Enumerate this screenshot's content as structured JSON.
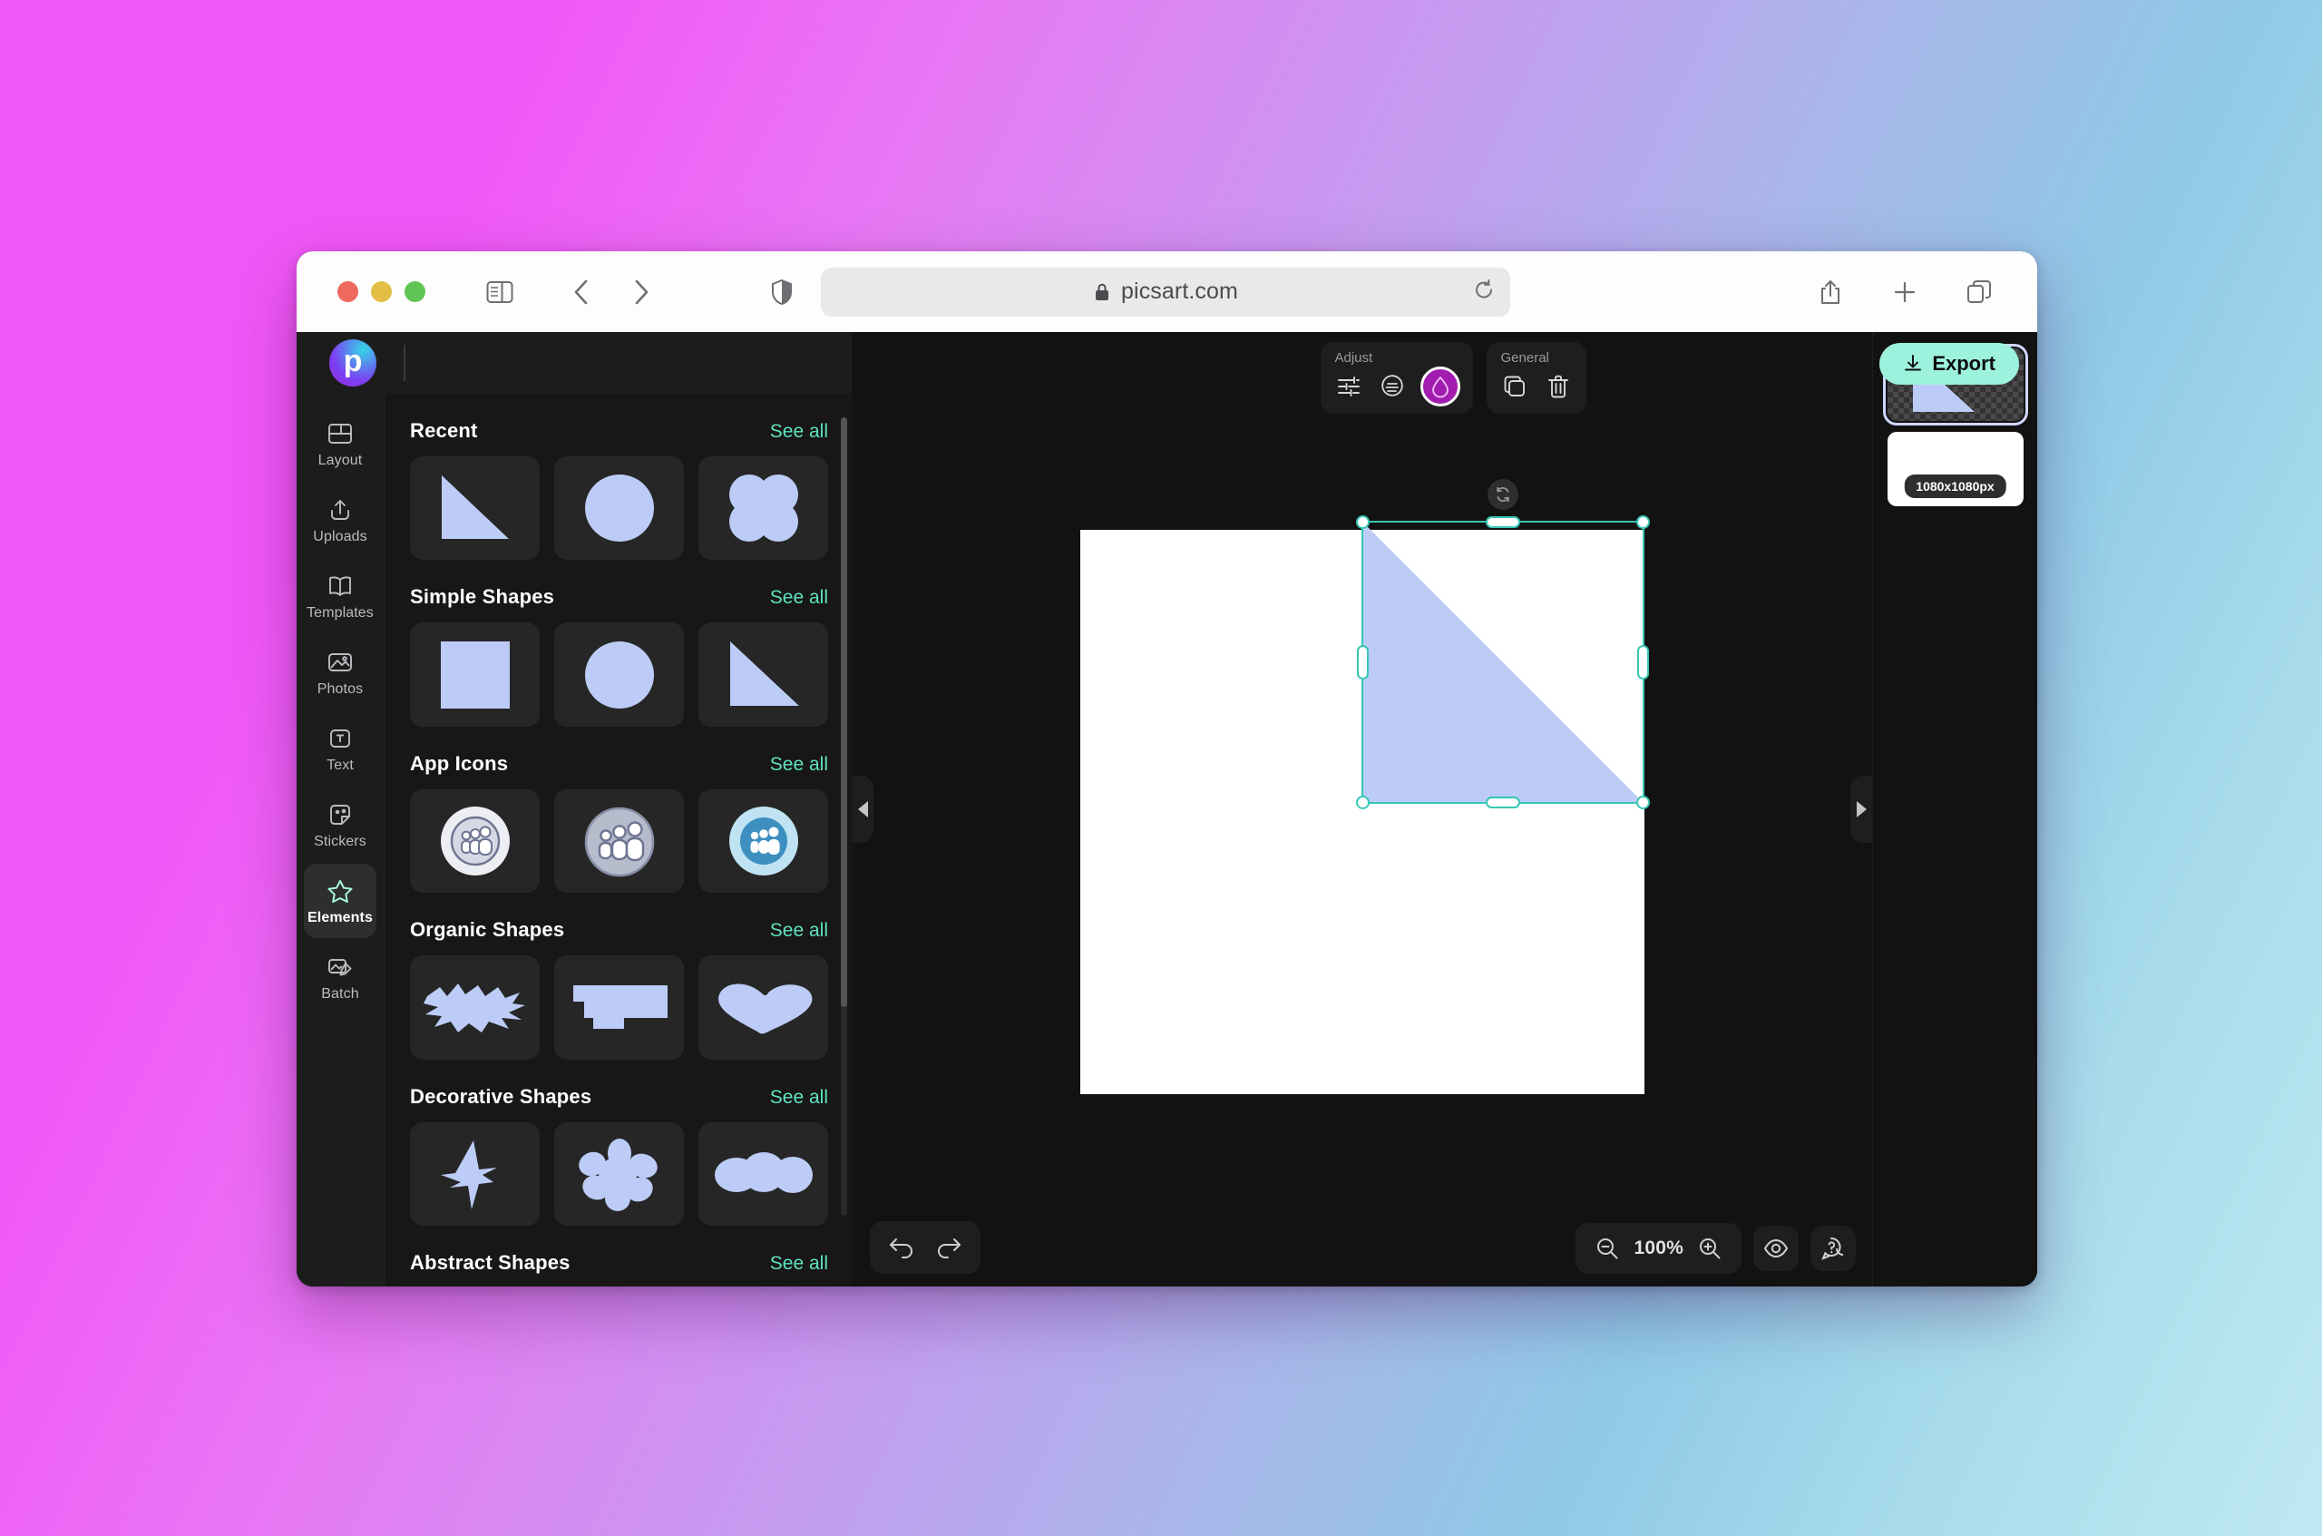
{
  "browser": {
    "url": "picsart.com",
    "lock_icon": "lock-icon",
    "controls": {
      "close": "close-window-button",
      "minimize": "minimize-window-button",
      "maximize": "maximize-window-button"
    },
    "sidebar_toggle_icon": "sidebar-toggle-icon",
    "back_icon": "back-chevron-icon",
    "forward_icon": "forward-chevron-icon",
    "shield_icon": "shield-privacy-icon",
    "reload_icon": "reload-icon",
    "share_icon": "share-icon",
    "new_tab_icon": "plus-icon",
    "tab_overview_icon": "tab-overview-icon"
  },
  "app": {
    "brand": "p",
    "export_label": "Export",
    "export_icon": "download-icon",
    "accent_mint": "#9cf2dc",
    "accent_teal": "#5fe3c0",
    "selection_color": "#38c7b4",
    "shape_fill": "#bcccf7",
    "active_color_swatch": "#a21caf"
  },
  "rail": {
    "items": [
      {
        "label": "Layout",
        "icon": "layout-icon",
        "active": false
      },
      {
        "label": "Uploads",
        "icon": "upload-icon",
        "active": false
      },
      {
        "label": "Templates",
        "icon": "templates-icon",
        "active": false
      },
      {
        "label": "Photos",
        "icon": "photos-icon",
        "active": false
      },
      {
        "label": "Text",
        "icon": "text-icon",
        "active": false
      },
      {
        "label": "Stickers",
        "icon": "stickers-icon",
        "active": false
      },
      {
        "label": "Elements",
        "icon": "star-icon",
        "active": true
      },
      {
        "label": "Batch",
        "icon": "batch-icon",
        "active": false
      }
    ]
  },
  "panel": {
    "see_all_label": "See all",
    "sections": [
      {
        "title": "Recent",
        "tiles": [
          "triangle",
          "circle",
          "clover"
        ]
      },
      {
        "title": "Simple Shapes",
        "tiles": [
          "square",
          "circle",
          "triangle"
        ]
      },
      {
        "title": "App Icons",
        "tiles": [
          "people-light",
          "people-gray",
          "people-blue"
        ]
      },
      {
        "title": "Organic Shapes",
        "tiles": [
          "scribble-blob",
          "stepped-rect",
          "heart-blob"
        ]
      },
      {
        "title": "Decorative Shapes",
        "tiles": [
          "bird",
          "flower",
          "triple-blob"
        ]
      },
      {
        "title": "Abstract Shapes",
        "tiles": []
      }
    ]
  },
  "toolbar": {
    "groups": [
      {
        "label": "Adjust",
        "icons": [
          "sliders-icon",
          "blend-icon",
          "color-droplet-icon"
        ]
      },
      {
        "label": "General",
        "icons": [
          "duplicate-icon",
          "trash-icon"
        ]
      }
    ]
  },
  "canvas": {
    "rotate_icon": "rotate-handle-icon",
    "left_collapse_icon": "collapse-left-icon",
    "right_collapse_icon": "collapse-right-icon",
    "undo_icon": "undo-icon",
    "redo_icon": "redo-icon",
    "zoom_out_icon": "zoom-out-icon",
    "zoom_level": "100%",
    "zoom_in_icon": "zoom-in-icon",
    "preview_icon": "eye-preview-icon",
    "help_icon": "help-icon"
  },
  "layers": {
    "items": [
      {
        "name": "shape-layer",
        "type": "transparent",
        "selected": true,
        "menu_icon": "more-options-icon"
      },
      {
        "name": "background-layer",
        "type": "white",
        "selected": false,
        "badge": "1080x1080px"
      }
    ]
  }
}
